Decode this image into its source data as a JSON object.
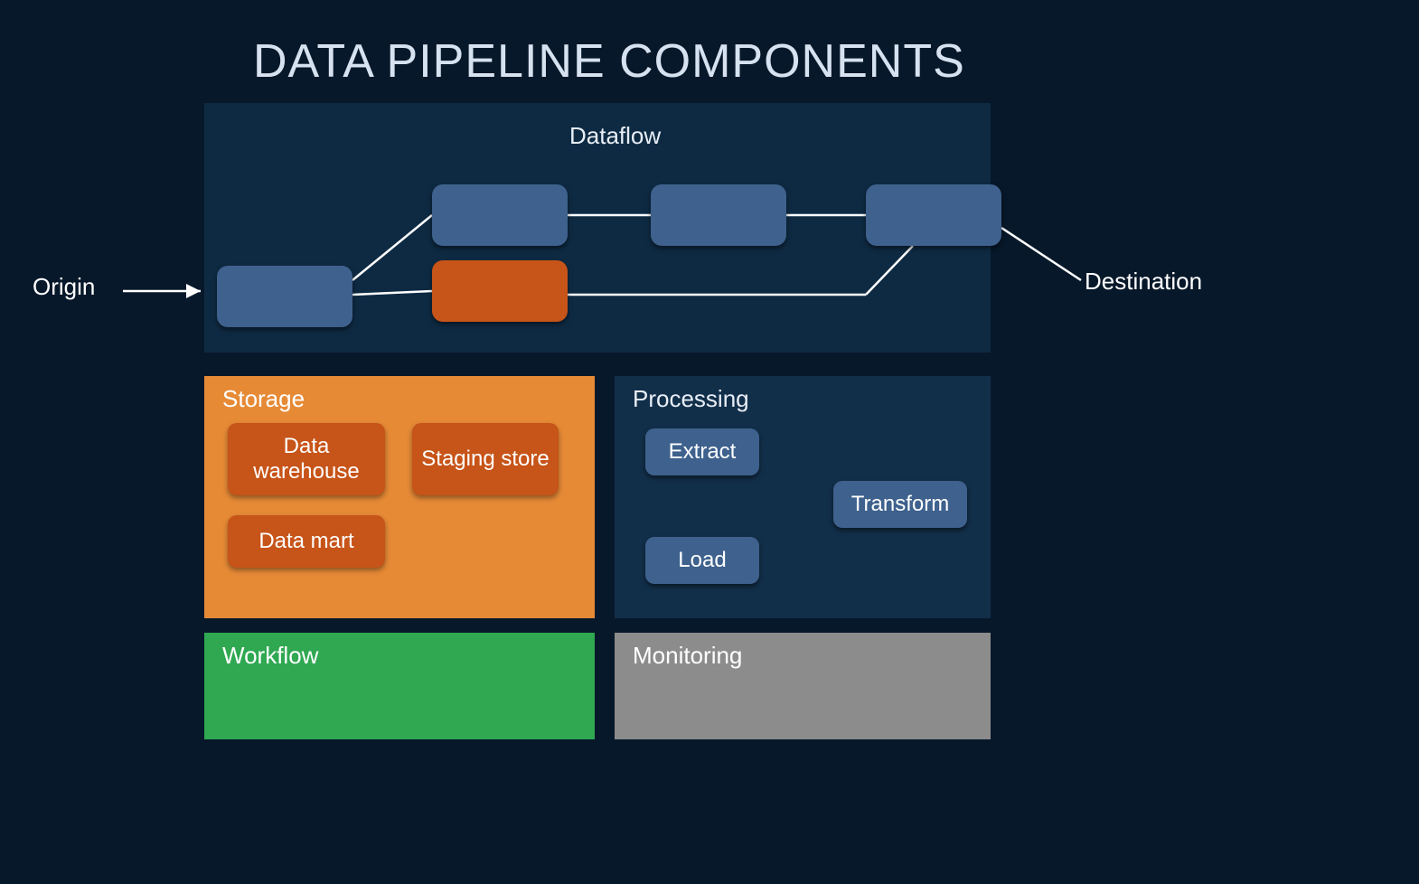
{
  "title": "DATA PIPELINE COMPONENTS",
  "origin_label": "Origin",
  "destination_label": "Destination",
  "dataflow": {
    "label": "Dataflow",
    "nodes": [
      {
        "id": "n1",
        "kind": "source",
        "color": "blue"
      },
      {
        "id": "n2",
        "kind": "step",
        "color": "blue"
      },
      {
        "id": "n3",
        "kind": "step",
        "color": "orange"
      },
      {
        "id": "n4",
        "kind": "step",
        "color": "blue"
      },
      {
        "id": "n5",
        "kind": "sink",
        "color": "blue"
      }
    ],
    "edges": [
      [
        "origin",
        "n1"
      ],
      [
        "n1",
        "n2"
      ],
      [
        "n1",
        "n3"
      ],
      [
        "n2",
        "n4"
      ],
      [
        "n4",
        "n5"
      ],
      [
        "n3",
        "n5"
      ],
      [
        "n5",
        "destination"
      ]
    ]
  },
  "storage": {
    "label": "Storage",
    "items": {
      "data_warehouse": "Data warehouse",
      "staging_store": "Staging store",
      "data_mart": "Data mart"
    }
  },
  "processing": {
    "label": "Processing",
    "items": {
      "extract": "Extract",
      "load": "Load",
      "transform": "Transform"
    },
    "edges": [
      [
        "extract",
        "transform"
      ],
      [
        "load",
        "transform"
      ]
    ]
  },
  "workflow": {
    "label": "Workflow"
  },
  "monitoring": {
    "label": "Monitoring"
  },
  "colors": {
    "background": "#07182a",
    "panel_dataflow": "#0e2a43",
    "panel_storage": "#e68a36",
    "panel_processing": "#122f4a",
    "panel_workflow": "#2fa851",
    "panel_monitoring": "#8c8c8c",
    "node_blue": "#3e618d",
    "node_orange": "#c75418",
    "line": "#ffffff"
  }
}
